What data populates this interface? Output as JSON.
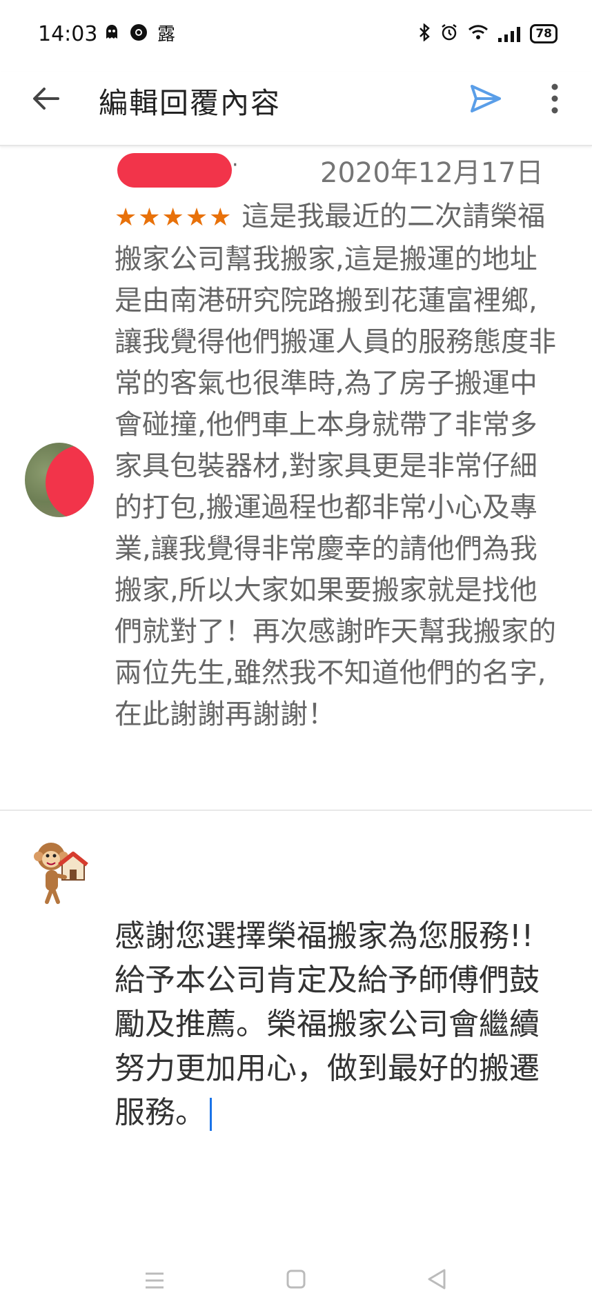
{
  "status_bar": {
    "time": "14:03",
    "left_icons": [
      "ghost-icon",
      "chrome-icon",
      "weather-icon"
    ],
    "weather_glyph": "露",
    "right_icons": [
      "bluetooth-icon",
      "alarm-icon",
      "wifi-icon",
      "signal-icon",
      "battery-icon"
    ],
    "battery_level": "78"
  },
  "app_bar": {
    "title": "編輯回覆內容",
    "back_icon": "arrow-left-icon",
    "send_icon": "send-icon",
    "more_icon": "more-vert-icon"
  },
  "review": {
    "date": "2020年12月17日",
    "stars": "★★★★★",
    "rating": 5,
    "body": "這是我最近的二次請榮福搬家公司幫我搬家,這是搬運的地址是由南港研究院路搬到花蓮富裡鄉,讓我覺得他們搬運人員的服務態度非常的客氣也很準時,為了房子搬運中會碰撞,他們車上本身就帶了非常多家具包裝器材,對家具更是非常仔細的打包,搬運過程也都非常小心及專業,讓我覺得非常慶幸的請他們為我搬家,所以大家如果要搬家就是找他們就對了！再次感謝昨天幫我搬家的兩位先生,雖然我不知道他們的名字,在此謝謝再謝謝！"
  },
  "reply": {
    "text": "感謝您選擇榮福搬家為您服務!! 給予本公司肯定及給予師傅們鼓勵及推薦。榮福搬家公司會繼續努力更加用心，做到最好的搬遷服務。"
  },
  "colors": {
    "star": "#e8710a",
    "accent": "#1a73e8",
    "redaction": "#f2344a"
  },
  "nav_bar": {
    "icons": [
      "menu-icon",
      "home-icon",
      "back-triangle-icon"
    ]
  }
}
